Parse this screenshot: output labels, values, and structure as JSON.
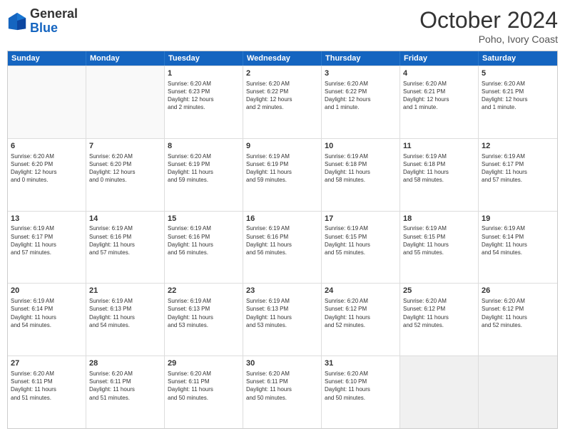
{
  "logo": {
    "general": "General",
    "blue": "Blue"
  },
  "header": {
    "month": "October 2024",
    "location": "Poho, Ivory Coast"
  },
  "weekdays": [
    "Sunday",
    "Monday",
    "Tuesday",
    "Wednesday",
    "Thursday",
    "Friday",
    "Saturday"
  ],
  "rows": [
    [
      {
        "day": "",
        "info": "",
        "empty": true
      },
      {
        "day": "",
        "info": "",
        "empty": true
      },
      {
        "day": "1",
        "info": "Sunrise: 6:20 AM\nSunset: 6:23 PM\nDaylight: 12 hours\nand 2 minutes."
      },
      {
        "day": "2",
        "info": "Sunrise: 6:20 AM\nSunset: 6:22 PM\nDaylight: 12 hours\nand 2 minutes."
      },
      {
        "day": "3",
        "info": "Sunrise: 6:20 AM\nSunset: 6:22 PM\nDaylight: 12 hours\nand 1 minute."
      },
      {
        "day": "4",
        "info": "Sunrise: 6:20 AM\nSunset: 6:21 PM\nDaylight: 12 hours\nand 1 minute."
      },
      {
        "day": "5",
        "info": "Sunrise: 6:20 AM\nSunset: 6:21 PM\nDaylight: 12 hours\nand 1 minute."
      }
    ],
    [
      {
        "day": "6",
        "info": "Sunrise: 6:20 AM\nSunset: 6:20 PM\nDaylight: 12 hours\nand 0 minutes."
      },
      {
        "day": "7",
        "info": "Sunrise: 6:20 AM\nSunset: 6:20 PM\nDaylight: 12 hours\nand 0 minutes."
      },
      {
        "day": "8",
        "info": "Sunrise: 6:20 AM\nSunset: 6:19 PM\nDaylight: 11 hours\nand 59 minutes."
      },
      {
        "day": "9",
        "info": "Sunrise: 6:19 AM\nSunset: 6:19 PM\nDaylight: 11 hours\nand 59 minutes."
      },
      {
        "day": "10",
        "info": "Sunrise: 6:19 AM\nSunset: 6:18 PM\nDaylight: 11 hours\nand 58 minutes."
      },
      {
        "day": "11",
        "info": "Sunrise: 6:19 AM\nSunset: 6:18 PM\nDaylight: 11 hours\nand 58 minutes."
      },
      {
        "day": "12",
        "info": "Sunrise: 6:19 AM\nSunset: 6:17 PM\nDaylight: 11 hours\nand 57 minutes."
      }
    ],
    [
      {
        "day": "13",
        "info": "Sunrise: 6:19 AM\nSunset: 6:17 PM\nDaylight: 11 hours\nand 57 minutes."
      },
      {
        "day": "14",
        "info": "Sunrise: 6:19 AM\nSunset: 6:16 PM\nDaylight: 11 hours\nand 57 minutes."
      },
      {
        "day": "15",
        "info": "Sunrise: 6:19 AM\nSunset: 6:16 PM\nDaylight: 11 hours\nand 56 minutes."
      },
      {
        "day": "16",
        "info": "Sunrise: 6:19 AM\nSunset: 6:16 PM\nDaylight: 11 hours\nand 56 minutes."
      },
      {
        "day": "17",
        "info": "Sunrise: 6:19 AM\nSunset: 6:15 PM\nDaylight: 11 hours\nand 55 minutes."
      },
      {
        "day": "18",
        "info": "Sunrise: 6:19 AM\nSunset: 6:15 PM\nDaylight: 11 hours\nand 55 minutes."
      },
      {
        "day": "19",
        "info": "Sunrise: 6:19 AM\nSunset: 6:14 PM\nDaylight: 11 hours\nand 54 minutes."
      }
    ],
    [
      {
        "day": "20",
        "info": "Sunrise: 6:19 AM\nSunset: 6:14 PM\nDaylight: 11 hours\nand 54 minutes."
      },
      {
        "day": "21",
        "info": "Sunrise: 6:19 AM\nSunset: 6:13 PM\nDaylight: 11 hours\nand 54 minutes."
      },
      {
        "day": "22",
        "info": "Sunrise: 6:19 AM\nSunset: 6:13 PM\nDaylight: 11 hours\nand 53 minutes."
      },
      {
        "day": "23",
        "info": "Sunrise: 6:19 AM\nSunset: 6:13 PM\nDaylight: 11 hours\nand 53 minutes."
      },
      {
        "day": "24",
        "info": "Sunrise: 6:20 AM\nSunset: 6:12 PM\nDaylight: 11 hours\nand 52 minutes."
      },
      {
        "day": "25",
        "info": "Sunrise: 6:20 AM\nSunset: 6:12 PM\nDaylight: 11 hours\nand 52 minutes."
      },
      {
        "day": "26",
        "info": "Sunrise: 6:20 AM\nSunset: 6:12 PM\nDaylight: 11 hours\nand 52 minutes."
      }
    ],
    [
      {
        "day": "27",
        "info": "Sunrise: 6:20 AM\nSunset: 6:11 PM\nDaylight: 11 hours\nand 51 minutes."
      },
      {
        "day": "28",
        "info": "Sunrise: 6:20 AM\nSunset: 6:11 PM\nDaylight: 11 hours\nand 51 minutes."
      },
      {
        "day": "29",
        "info": "Sunrise: 6:20 AM\nSunset: 6:11 PM\nDaylight: 11 hours\nand 50 minutes."
      },
      {
        "day": "30",
        "info": "Sunrise: 6:20 AM\nSunset: 6:11 PM\nDaylight: 11 hours\nand 50 minutes."
      },
      {
        "day": "31",
        "info": "Sunrise: 6:20 AM\nSunset: 6:10 PM\nDaylight: 11 hours\nand 50 minutes."
      },
      {
        "day": "",
        "info": "",
        "empty": true,
        "shaded": true
      },
      {
        "day": "",
        "info": "",
        "empty": true,
        "shaded": true
      }
    ]
  ]
}
